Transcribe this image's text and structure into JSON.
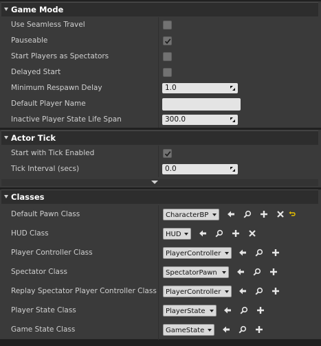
{
  "game_mode": {
    "header": "Game Mode",
    "rows": [
      {
        "label": "Use Seamless Travel",
        "checked": false
      },
      {
        "label": "Pauseable",
        "checked": true
      },
      {
        "label": "Start Players as Spectators",
        "checked": false
      },
      {
        "label": "Delayed Start",
        "checked": false
      },
      {
        "label": "Minimum Respawn Delay",
        "value": "1.0"
      },
      {
        "label": "Default Player Name",
        "value": ""
      },
      {
        "label": "Inactive Player State Life Span",
        "value": "300.0"
      }
    ]
  },
  "actor_tick": {
    "header": "Actor Tick",
    "rows": [
      {
        "label": "Start with Tick Enabled",
        "checked": true
      },
      {
        "label": "Tick Interval (secs)",
        "value": "0.0"
      }
    ]
  },
  "classes": {
    "header": "Classes",
    "rows": [
      {
        "label": "Default Pawn Class",
        "value": "CharacterBP"
      },
      {
        "label": "HUD Class",
        "value": "HUD"
      },
      {
        "label": "Player Controller Class",
        "value": "PlayerController"
      },
      {
        "label": "Spectator Class",
        "value": "SpectatorPawn"
      },
      {
        "label": "Replay Spectator Player Controller Class",
        "value": "PlayerController"
      },
      {
        "label": "Player State Class",
        "value": "PlayerState"
      },
      {
        "label": "Game State Class",
        "value": "GameState"
      }
    ]
  },
  "icons": {
    "use_selected": "arrow-left-icon",
    "browse": "magnifier-icon",
    "new": "plus-icon",
    "clear": "x-icon",
    "reset": "reset-to-default-icon"
  },
  "colors": {
    "panel_bg": "#3a3a3a",
    "header_bg": "#2d2d2d",
    "field_bg": "#e4e4e4",
    "reset_arrow": "#e8c000"
  }
}
